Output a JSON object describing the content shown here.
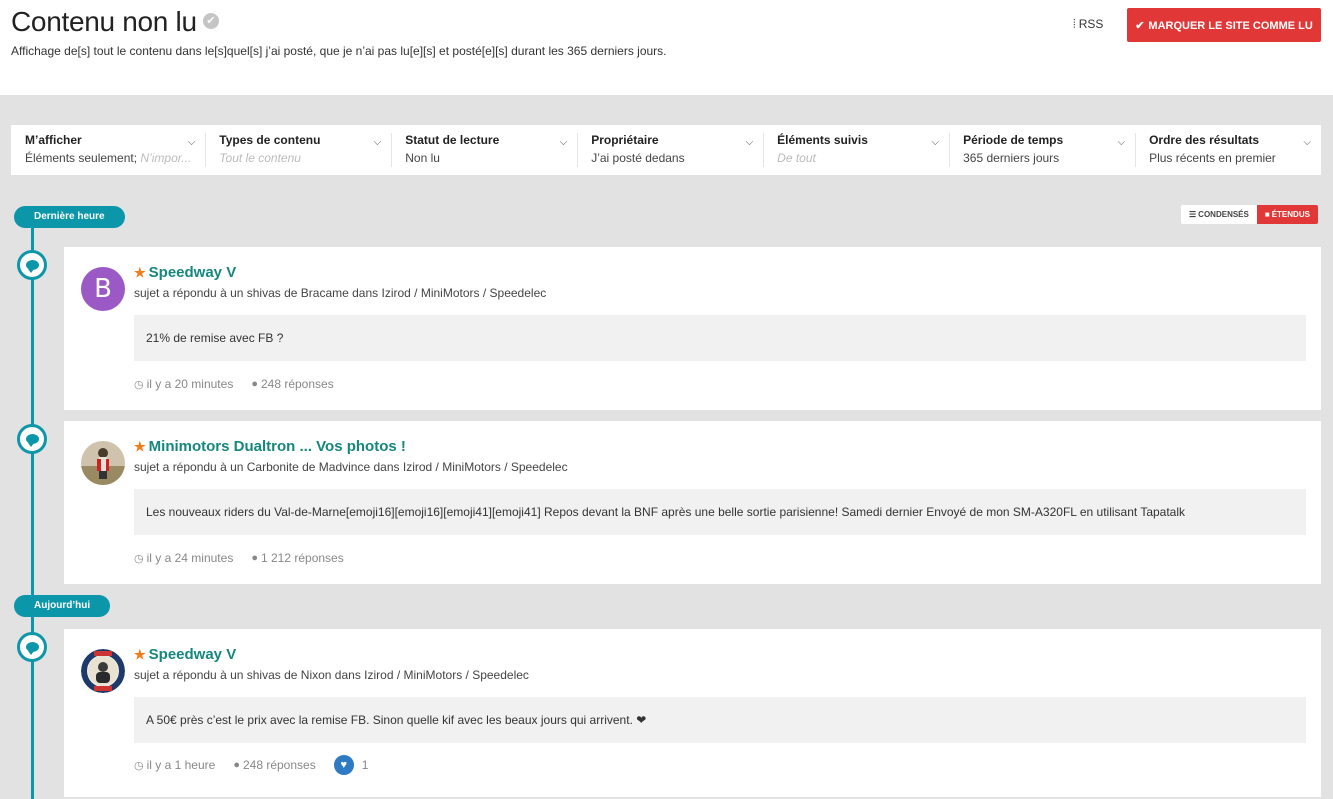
{
  "header": {
    "title": "Contenu non lu",
    "description": "Affichage de[s] tout le contenu dans le[s]quel[s] j’ai posté, que je n’ai pas lu[e][s] et posté[e][s] durant les 365 derniers jours.",
    "rss_label": "RSS",
    "mark_read_label": "MARQUER LE SITE COMME LU"
  },
  "filters": [
    {
      "title": "M’afficher",
      "value": "Éléments seulement;",
      "extra": " N’impor..."
    },
    {
      "title": "Types de contenu",
      "value": "Tout le contenu",
      "muted": true
    },
    {
      "title": "Statut de lecture",
      "value": "Non lu"
    },
    {
      "title": "Propriétaire",
      "value": "J’ai posté dedans"
    },
    {
      "title": "Éléments suivis",
      "value": "De tout",
      "muted": true
    },
    {
      "title": "Période de temps",
      "value": "365 derniers jours"
    },
    {
      "title": "Ordre des résultats",
      "value": "Plus récents en premier"
    }
  ],
  "view_toggle": {
    "condensed": "CONDENSÉS",
    "expanded": "ÉTENDUS"
  },
  "time_groups": [
    "Dernière heure",
    "Aujourd’hui"
  ],
  "posts": [
    {
      "title": "Speedway V",
      "subtitle_prefix": "sujet a répondu à un shivas de Bracame dans",
      "breadcrumb": "Izirod / MiniMotors / Speedelec",
      "avatar_letter": "B",
      "excerpt": "21% de remise avec FB ?",
      "time": "il y a 20 minutes",
      "replies": "248 réponses"
    },
    {
      "title": "Minimotors Dualtron ... Vos photos !",
      "subtitle_prefix": "sujet a répondu à un Carbonite de Madvince dans",
      "breadcrumb": "Izirod / MiniMotors / Speedelec",
      "excerpt": "Les nouveaux riders du Val-de-Marne[emoji16][emoji16][emoji41][emoji41] Repos devant la BNF après une belle sortie parisienne! Samedi dernier Envoyé de mon SM-A320FL en utilisant Tapatalk",
      "time": "il y a 24 minutes",
      "replies": "1 212 réponses"
    },
    {
      "title": "Speedway V",
      "subtitle_prefix": "sujet a répondu à un shivas de Nixon dans",
      "breadcrumb": "Izirod / MiniMotors / Speedelec",
      "excerpt": "A 50€ près c’est le prix avec la remise FB. Sinon quelle kif avec les beaux jours qui arrivent. ❤",
      "time": "il y a 1 heure",
      "replies": "248 réponses",
      "reactions": "1"
    }
  ]
}
